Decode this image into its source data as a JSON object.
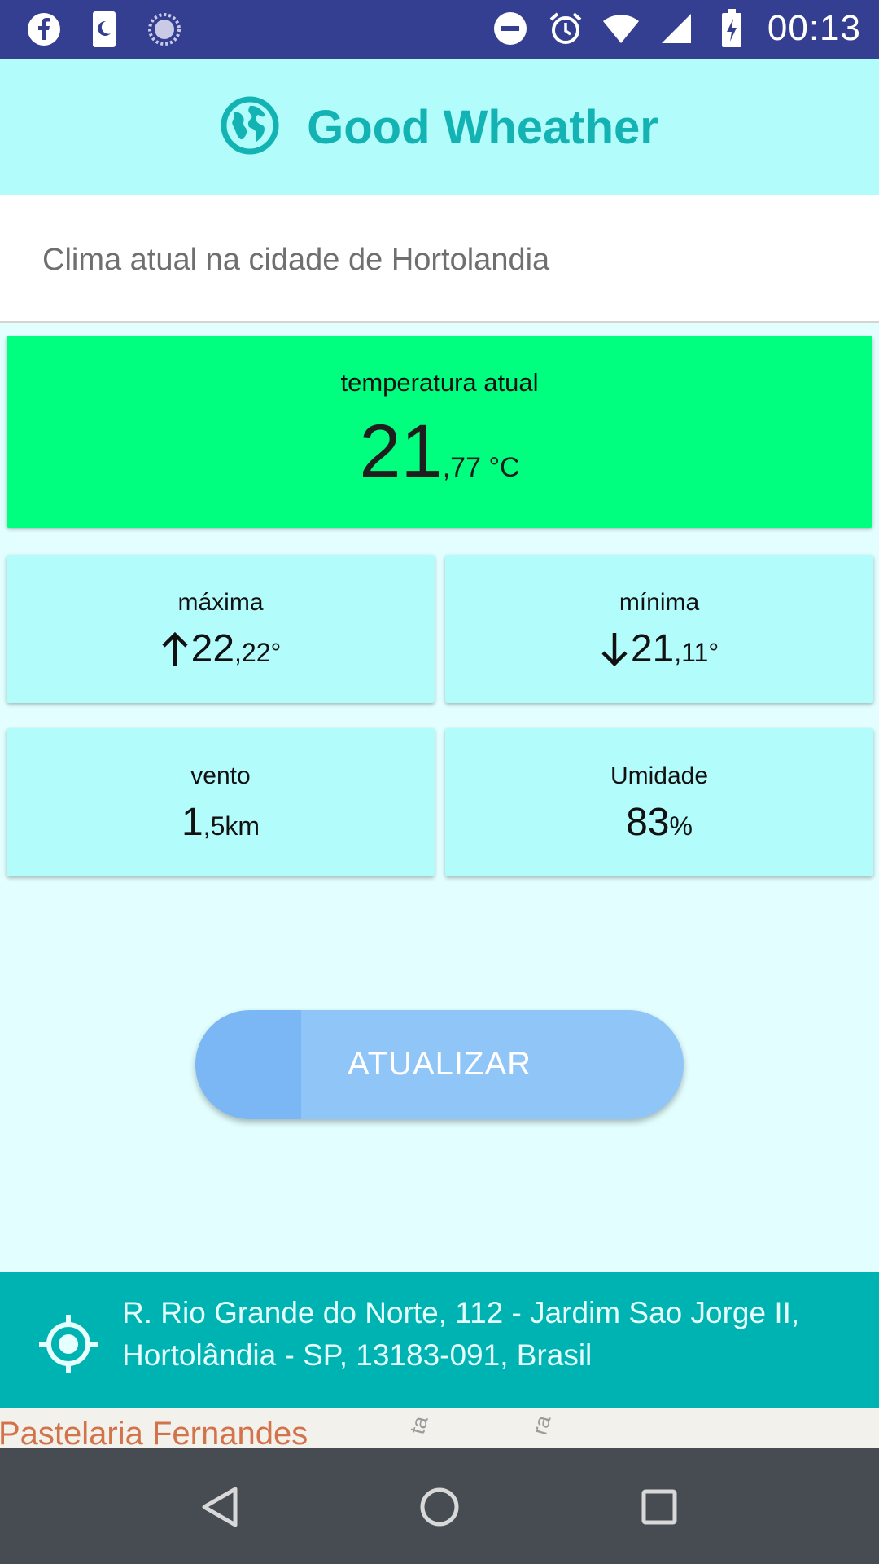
{
  "status_bar": {
    "time": "00:13",
    "left_icons": [
      "facebook-icon",
      "sleep-icon",
      "loading-icon"
    ],
    "right_icons": [
      "do-not-disturb-icon",
      "alarm-icon",
      "wifi-icon",
      "signal-icon",
      "battery-charging-icon"
    ]
  },
  "header": {
    "title": "Good Wheather",
    "icon": "globe-icon"
  },
  "city": {
    "text": "Clima atual na cidade de Hortolandia"
  },
  "temperature": {
    "label": "temperatura atual",
    "integer": "21",
    "decimal": ",77 °C"
  },
  "cards": {
    "max": {
      "label": "máxima",
      "integer": "22",
      "decimal": ",22°",
      "icon": "arrow-up-icon"
    },
    "min": {
      "label": "mínima",
      "integer": "21",
      "decimal": ",11°",
      "icon": "arrow-down-icon"
    },
    "wind": {
      "label": "vento",
      "integer": "1",
      "decimal": ",5km"
    },
    "humidity": {
      "label": "Umidade",
      "integer": "83",
      "decimal": "%"
    }
  },
  "button": {
    "label": "ATUALIZAR"
  },
  "address": {
    "line1": "R. Rio Grande do Norte, 112 - Jardim Sao Jorge II,",
    "line2": "Hortolândia - SP, 13183-091, Brasil",
    "icon": "location-target-icon"
  },
  "map": {
    "poi": "Pastelaria Fernandes",
    "road1": "ta",
    "road2": "ra"
  },
  "colors": {
    "status_bar": "#353f91",
    "header_bg": "#b3fcfc",
    "title": "#14b3b3",
    "temperature_card": "#00ff7f",
    "card_bg": "#b3fcfc",
    "button": "#90c5f8",
    "address_bar": "#00b3b3",
    "nav_bar": "#464c52"
  }
}
